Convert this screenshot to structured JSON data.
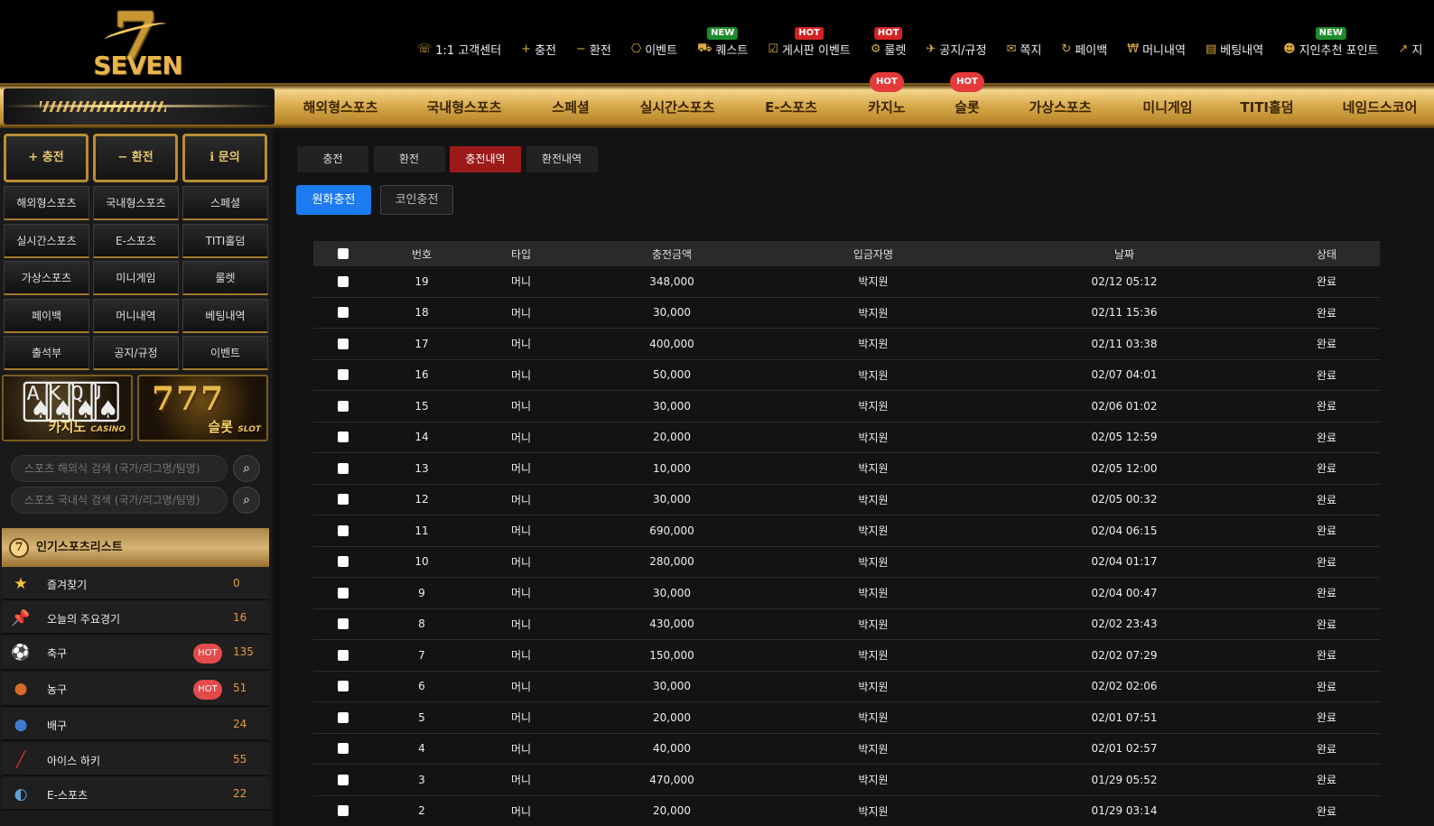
{
  "logo": {
    "mark": "7",
    "text": "SEVEN"
  },
  "top_menu": [
    {
      "icon": "☏",
      "icon_name": "headset-icon",
      "label": "1:1 고객센터",
      "badge": ""
    },
    {
      "icon": "+",
      "icon_name": "plus-icon",
      "label": "충전",
      "badge": ""
    },
    {
      "icon": "−",
      "icon_name": "minus-icon",
      "label": "환전",
      "badge": ""
    },
    {
      "icon": "⎔",
      "icon_name": "gift-icon",
      "label": "이벤트",
      "badge": ""
    },
    {
      "icon": "⛟",
      "icon_name": "quest-icon",
      "label": "퀘스트",
      "badge": "NEW"
    },
    {
      "icon": "☑",
      "icon_name": "checkbox-icon",
      "label": "게시판 이벤트",
      "badge": "HOT"
    },
    {
      "icon": "⚙",
      "icon_name": "roulette-icon",
      "label": "룰렛",
      "badge": "HOT"
    },
    {
      "icon": "✈",
      "icon_name": "megaphone-icon",
      "label": "공지/규정",
      "badge": ""
    },
    {
      "icon": "✉",
      "icon_name": "envelope-icon",
      "label": "쪽지",
      "badge": ""
    },
    {
      "icon": "↻",
      "icon_name": "refresh-icon",
      "label": "페이백",
      "badge": ""
    },
    {
      "icon": "₩",
      "icon_name": "moneybag-icon",
      "label": "머니내역",
      "badge": ""
    },
    {
      "icon": "▤",
      "icon_name": "ticket-icon",
      "label": "베팅내역",
      "badge": ""
    },
    {
      "icon": "☻",
      "icon_name": "users-icon",
      "label": "지인추천 포인트",
      "badge": "NEW"
    },
    {
      "icon": "↗",
      "icon_name": "arrow-icon",
      "label": "지",
      "badge": ""
    }
  ],
  "gold_nav": [
    {
      "label": "해외형스포츠",
      "badge": ""
    },
    {
      "label": "국내형스포츠",
      "badge": ""
    },
    {
      "label": "스페셜",
      "badge": ""
    },
    {
      "label": "실시간스포츠",
      "badge": ""
    },
    {
      "label": "E-스포츠",
      "badge": ""
    },
    {
      "label": "카지노",
      "badge": "HOT"
    },
    {
      "label": "슬롯",
      "badge": "HOT"
    },
    {
      "label": "가상스포츠",
      "badge": ""
    },
    {
      "label": "미니게임",
      "badge": ""
    },
    {
      "label": "TITI홀덤",
      "badge": ""
    },
    {
      "label": "네임드스코어",
      "badge": ""
    }
  ],
  "sidebar": {
    "actions": [
      "+ 충전",
      "− 환전",
      "ℹ 문의"
    ],
    "grid": [
      "해외형스포츠",
      "국내형스포츠",
      "스페셜",
      "실시간스포츠",
      "E-스포츠",
      "TITI홀덤",
      "가상스포츠",
      "미니게임",
      "룰렛",
      "페이백",
      "머니내역",
      "베팅내역",
      "출석부",
      "공지/규정",
      "이벤트"
    ],
    "banners": {
      "casino": {
        "label": "카지노",
        "sub": "CASINO"
      },
      "slot": {
        "label": "슬롯",
        "sub": "SLOT"
      }
    },
    "search": {
      "overseas_placeholder": "스포츠 해외식 검색 (국가/리그명/팀명)",
      "domestic_placeholder": "스포츠 국내식 검색 (국가/리그명/팀명)"
    },
    "popular_title": "인기스포츠리스트",
    "sports": [
      {
        "icon": "★",
        "icon_name": "star-icon",
        "icon_color": "#f3c53a",
        "name": "즐겨찾기",
        "count": "0",
        "hot": ""
      },
      {
        "icon": "📌",
        "icon_name": "pin-icon",
        "icon_color": "#e33",
        "name": "오늘의 주요경기",
        "count": "16",
        "hot": ""
      },
      {
        "icon": "⚽",
        "icon_name": "soccer-ball-icon",
        "icon_color": "#fff",
        "name": "축구",
        "count": "135",
        "hot": "HOT"
      },
      {
        "icon": "●",
        "icon_name": "basketball-icon",
        "icon_color": "#d9692a",
        "name": "농구",
        "count": "51",
        "hot": "HOT"
      },
      {
        "icon": "●",
        "icon_name": "volleyball-icon",
        "icon_color": "#3f7ad0",
        "name": "배구",
        "count": "24",
        "hot": ""
      },
      {
        "icon": "╱",
        "icon_name": "hockey-stick-icon",
        "icon_color": "#c33",
        "name": "아이스 하키",
        "count": "55",
        "hot": ""
      },
      {
        "icon": "◐",
        "icon_name": "esports-icon",
        "icon_color": "#5fa3d6",
        "name": "E-스포츠",
        "count": "22",
        "hot": ""
      }
    ]
  },
  "main": {
    "tabs": [
      {
        "label": "충전",
        "active": false
      },
      {
        "label": "환전",
        "active": false
      },
      {
        "label": "충전내역",
        "active": true
      },
      {
        "label": "환전내역",
        "active": false
      }
    ],
    "subtabs": {
      "won": "원화충전",
      "coin": "코인충전"
    },
    "table": {
      "headers": {
        "no": "번호",
        "type": "타입",
        "amount": "충전금액",
        "depositor": "입금자명",
        "date": "날짜",
        "status": "상태"
      },
      "rows": [
        {
          "no": "19",
          "type": "머니",
          "amount": "348,000",
          "depositor": "박지원",
          "date": "02/12 05:12",
          "status": "완료"
        },
        {
          "no": "18",
          "type": "머니",
          "amount": "30,000",
          "depositor": "박지원",
          "date": "02/11 15:36",
          "status": "완료"
        },
        {
          "no": "17",
          "type": "머니",
          "amount": "400,000",
          "depositor": "박지원",
          "date": "02/11 03:38",
          "status": "완료"
        },
        {
          "no": "16",
          "type": "머니",
          "amount": "50,000",
          "depositor": "박지원",
          "date": "02/07 04:01",
          "status": "완료"
        },
        {
          "no": "15",
          "type": "머니",
          "amount": "30,000",
          "depositor": "박지원",
          "date": "02/06 01:02",
          "status": "완료"
        },
        {
          "no": "14",
          "type": "머니",
          "amount": "20,000",
          "depositor": "박지원",
          "date": "02/05 12:59",
          "status": "완료"
        },
        {
          "no": "13",
          "type": "머니",
          "amount": "10,000",
          "depositor": "박지원",
          "date": "02/05 12:00",
          "status": "완료"
        },
        {
          "no": "12",
          "type": "머니",
          "amount": "30,000",
          "depositor": "박지원",
          "date": "02/05 00:32",
          "status": "완료"
        },
        {
          "no": "11",
          "type": "머니",
          "amount": "690,000",
          "depositor": "박지원",
          "date": "02/04 06:15",
          "status": "완료"
        },
        {
          "no": "10",
          "type": "머니",
          "amount": "280,000",
          "depositor": "박지원",
          "date": "02/04 01:17",
          "status": "완료"
        },
        {
          "no": "9",
          "type": "머니",
          "amount": "30,000",
          "depositor": "박지원",
          "date": "02/04 00:47",
          "status": "완료"
        },
        {
          "no": "8",
          "type": "머니",
          "amount": "430,000",
          "depositor": "박지원",
          "date": "02/02 23:43",
          "status": "완료"
        },
        {
          "no": "7",
          "type": "머니",
          "amount": "150,000",
          "depositor": "박지원",
          "date": "02/02 07:29",
          "status": "완료"
        },
        {
          "no": "6",
          "type": "머니",
          "amount": "30,000",
          "depositor": "박지원",
          "date": "02/02 02:06",
          "status": "완료"
        },
        {
          "no": "5",
          "type": "머니",
          "amount": "20,000",
          "depositor": "박지원",
          "date": "02/01 07:51",
          "status": "완료"
        },
        {
          "no": "4",
          "type": "머니",
          "amount": "40,000",
          "depositor": "박지원",
          "date": "02/01 02:57",
          "status": "완료"
        },
        {
          "no": "3",
          "type": "머니",
          "amount": "470,000",
          "depositor": "박지원",
          "date": "01/29 05:52",
          "status": "완료"
        },
        {
          "no": "2",
          "type": "머니",
          "amount": "20,000",
          "depositor": "박지원",
          "date": "01/29 03:14",
          "status": "완료"
        }
      ]
    }
  }
}
